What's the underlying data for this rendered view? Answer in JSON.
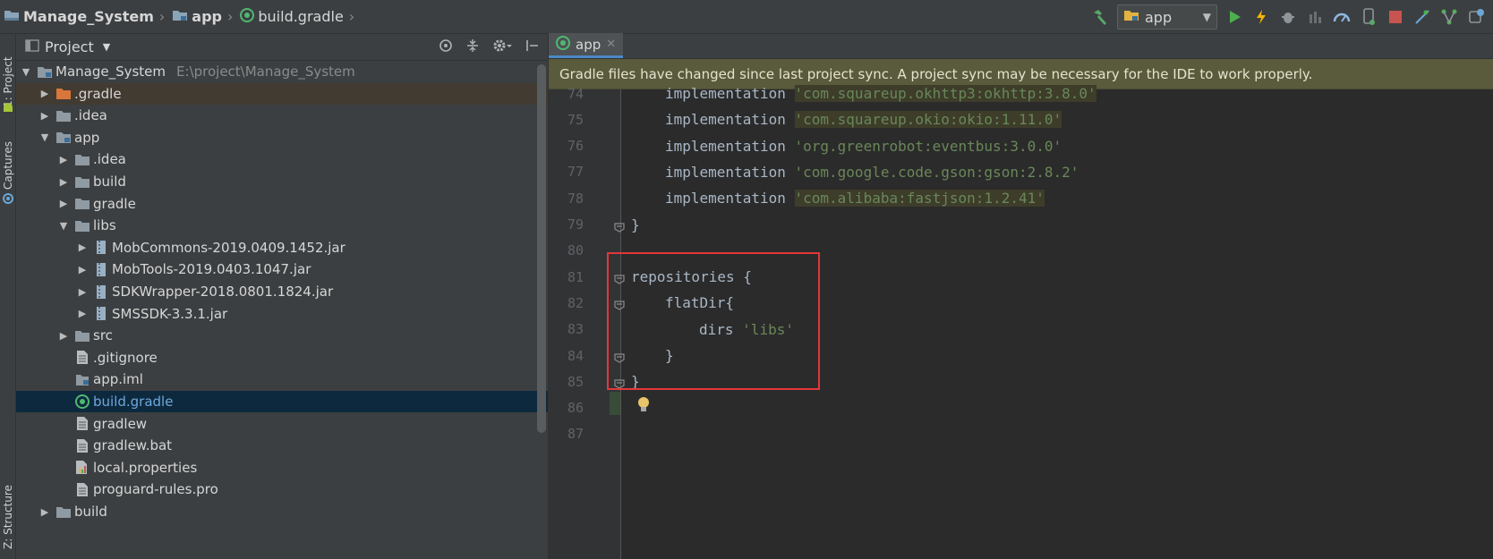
{
  "breadcrumb": {
    "project": "Manage_System",
    "module": "app",
    "file": "build.gradle"
  },
  "toolbar": {
    "run_config": "app",
    "icons": [
      "hammer-icon",
      "run-icon",
      "apply-changes-icon",
      "debug-icon",
      "attach-icon",
      "profile-icon",
      "avd-icon",
      "stop-icon",
      "sync-icon",
      "sdk-icon",
      "device-icon"
    ],
    "colors": {
      "run": "#4caf50",
      "stop": "#c75450",
      "hammer": "#59a869",
      "lightning": "#f4b400"
    }
  },
  "vertical_tabs": {
    "project": "1: Project",
    "captures": "Captures",
    "structure": "Z: Structure"
  },
  "project_panel": {
    "title": "Project",
    "tree": [
      {
        "name": "Manage_System",
        "path": "E:\\project\\Manage_System",
        "depth": 0,
        "arrow": "down",
        "icon": "module-folder-icon"
      },
      {
        "name": ".gradle",
        "depth": 1,
        "arrow": "right",
        "icon": "folder-orange-icon",
        "highlight": true
      },
      {
        "name": ".idea",
        "depth": 1,
        "arrow": "right",
        "icon": "folder-icon"
      },
      {
        "name": "app",
        "depth": 1,
        "arrow": "down",
        "icon": "module-folder-icon"
      },
      {
        "name": ".idea",
        "depth": 2,
        "arrow": "right",
        "icon": "folder-icon"
      },
      {
        "name": "build",
        "depth": 2,
        "arrow": "right",
        "icon": "folder-icon"
      },
      {
        "name": "gradle",
        "depth": 2,
        "arrow": "right",
        "icon": "folder-icon"
      },
      {
        "name": "libs",
        "depth": 2,
        "arrow": "down",
        "icon": "folder-icon"
      },
      {
        "name": "MobCommons-2019.0409.1452.jar",
        "depth": 3,
        "arrow": "right",
        "icon": "jar-icon"
      },
      {
        "name": "MobTools-2019.0403.1047.jar",
        "depth": 3,
        "arrow": "right",
        "icon": "jar-icon"
      },
      {
        "name": "SDKWrapper-2018.0801.1824.jar",
        "depth": 3,
        "arrow": "right",
        "icon": "jar-icon"
      },
      {
        "name": "SMSSDK-3.3.1.jar",
        "depth": 3,
        "arrow": "right",
        "icon": "jar-icon"
      },
      {
        "name": "src",
        "depth": 2,
        "arrow": "right",
        "icon": "folder-icon"
      },
      {
        "name": ".gitignore",
        "depth": 2,
        "arrow": "none",
        "icon": "file-icon"
      },
      {
        "name": "app.iml",
        "depth": 2,
        "arrow": "none",
        "icon": "iml-icon"
      },
      {
        "name": "build.gradle",
        "depth": 2,
        "arrow": "none",
        "icon": "gradle-icon",
        "selected": true
      },
      {
        "name": "gradlew",
        "depth": 2,
        "arrow": "none",
        "icon": "file-icon"
      },
      {
        "name": "gradlew.bat",
        "depth": 2,
        "arrow": "none",
        "icon": "file-icon"
      },
      {
        "name": "local.properties",
        "depth": 2,
        "arrow": "none",
        "icon": "properties-icon"
      },
      {
        "name": "proguard-rules.pro",
        "depth": 2,
        "arrow": "none",
        "icon": "file-icon"
      },
      {
        "name": "build",
        "depth": 1,
        "arrow": "right",
        "icon": "folder-icon"
      }
    ]
  },
  "editor": {
    "tab": "app",
    "banner": "Gradle files have changed since last project sync. A project sync may be necessary for the IDE to work properly.",
    "lines": [
      {
        "num": "74",
        "kw": "implementation ",
        "str": "'com.squareup.okhttp3:okhttp:3.8.0'",
        "indent": 1,
        "strhl": true
      },
      {
        "num": "75",
        "kw": "implementation ",
        "str": "'com.squareup.okio:okio:1.11.0'",
        "indent": 1,
        "strhl": true
      },
      {
        "num": "76",
        "kw": "implementation ",
        "str": "'org.greenrobot:eventbus:3.0.0'",
        "indent": 1
      },
      {
        "num": "77",
        "kw": "implementation ",
        "str": "'com.google.code.gson:gson:2.8.2'",
        "indent": 1
      },
      {
        "num": "78",
        "kw": "implementation ",
        "str": "'com.alibaba:fastjson:1.2.41'",
        "indent": 1,
        "strhl": true
      },
      {
        "num": "79",
        "kw": "}",
        "str": "",
        "indent": 0
      },
      {
        "num": "80",
        "kw": "",
        "str": "",
        "indent": 0
      },
      {
        "num": "81",
        "kw": "repositories {",
        "str": "",
        "indent": 0
      },
      {
        "num": "82",
        "kw": "flatDir{",
        "str": "",
        "indent": 1
      },
      {
        "num": "83",
        "kw": "dirs ",
        "str": "'libs'",
        "indent": 2
      },
      {
        "num": "84",
        "kw": "}",
        "str": "",
        "indent": 1
      },
      {
        "num": "85",
        "kw": "}",
        "str": "",
        "indent": 0
      },
      {
        "num": "86",
        "kw": "",
        "str": "",
        "indent": 0
      },
      {
        "num": "87",
        "kw": "",
        "str": "",
        "indent": 0
      }
    ]
  }
}
